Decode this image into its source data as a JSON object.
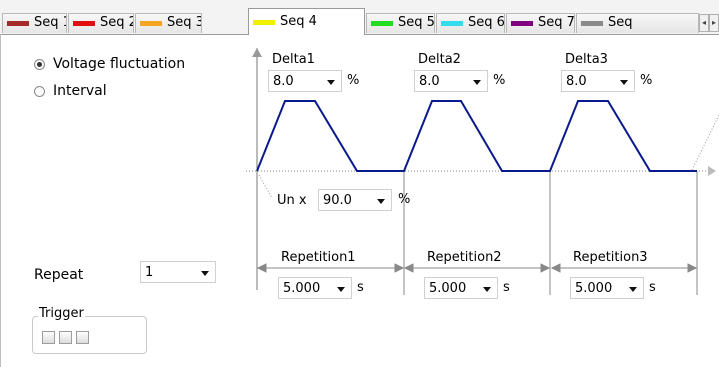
{
  "tabs": [
    {
      "label": "Seq 1",
      "color": "#a52a2a",
      "active": false
    },
    {
      "label": "Seq 2",
      "color": "#e01010",
      "active": false
    },
    {
      "label": "Seq 3",
      "color": "#f5a623",
      "active": false
    },
    {
      "label": "Seq 4",
      "color": "#f0f000",
      "active": true
    },
    {
      "label": "Seq 5",
      "color": "#22dd22",
      "active": false
    },
    {
      "label": "Seq 6",
      "color": "#33ddee",
      "active": false
    },
    {
      "label": "Seq 7",
      "color": "#800080",
      "active": false
    },
    {
      "label": "Seq",
      "color": "#8a8a8a",
      "active": false
    }
  ],
  "mode": {
    "options": [
      {
        "label": "Voltage fluctuation",
        "selected": true
      },
      {
        "label": "Interval",
        "selected": false
      }
    ]
  },
  "deltas": [
    {
      "label": "Delta1",
      "value": "8.0",
      "unit": "%"
    },
    {
      "label": "Delta2",
      "value": "8.0",
      "unit": "%"
    },
    {
      "label": "Delta3",
      "value": "8.0",
      "unit": "%"
    }
  ],
  "base": {
    "label": "Un x",
    "value": "90.0",
    "unit": "%"
  },
  "repetitions": [
    {
      "label": "Repetition1",
      "value": "5.000",
      "unit": "s"
    },
    {
      "label": "Repetition2",
      "value": "5.000",
      "unit": "s"
    },
    {
      "label": "Repetition3",
      "value": "5.000",
      "unit": "s"
    }
  ],
  "repeat": {
    "label": "Repeat",
    "value": "1"
  },
  "trigger": {
    "label": "Trigger",
    "checkboxes": [
      false,
      false,
      false
    ]
  },
  "colors": {
    "waveform": "#0a1a8c",
    "axis": "#888888"
  }
}
